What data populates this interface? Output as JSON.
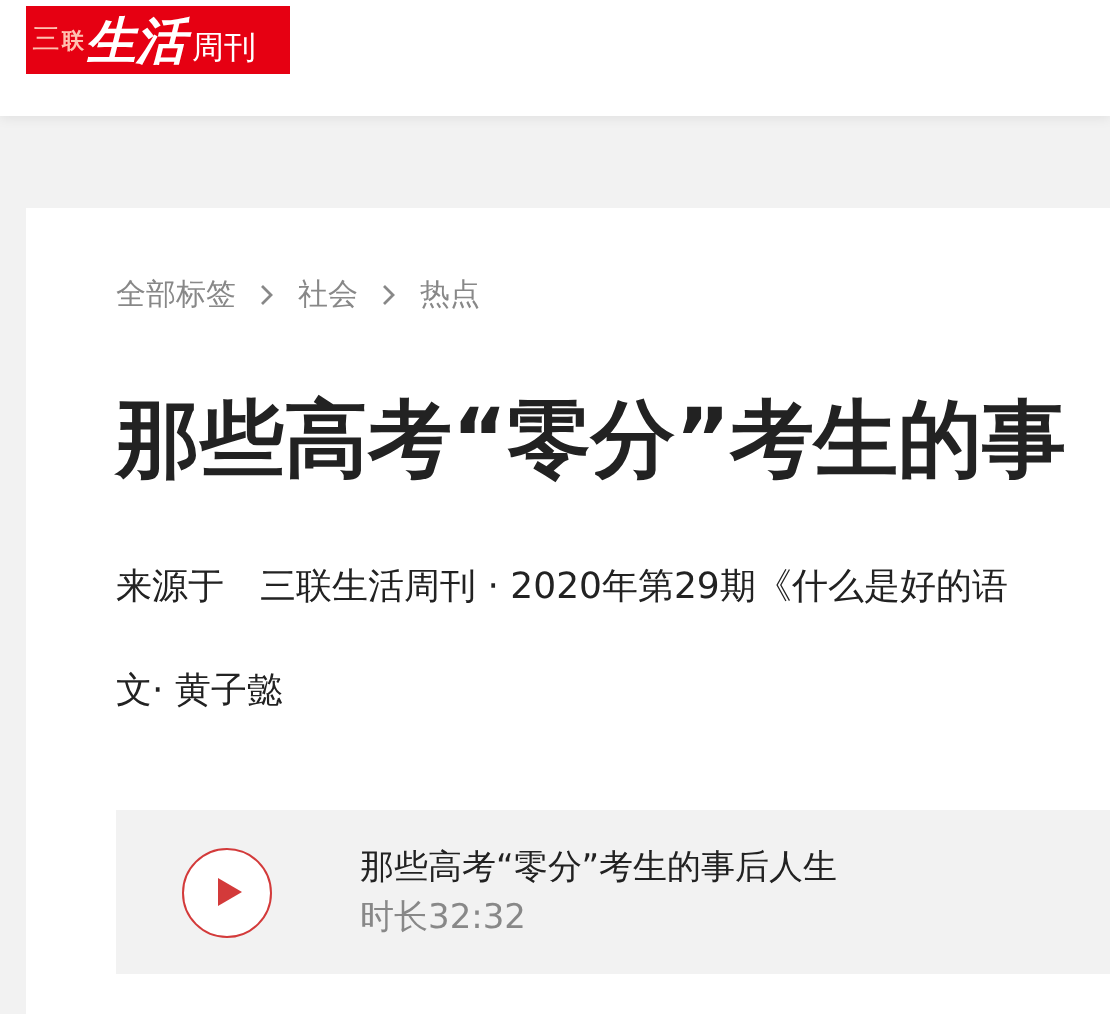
{
  "logo": {
    "mark": "三",
    "small": "联",
    "main": "生活",
    "suffix": "周刊"
  },
  "breadcrumb": [
    "全部标签",
    "社会",
    "热点"
  ],
  "article": {
    "title": "那些高考“零分”考生的事",
    "source_label": "来源于",
    "source": "三联生活周刊 · 2020年第29期《什么是好的语",
    "author": "文· 黄子懿"
  },
  "audio": {
    "title": "那些高考“零分”考生的事后人生",
    "duration": "时长32:32"
  }
}
